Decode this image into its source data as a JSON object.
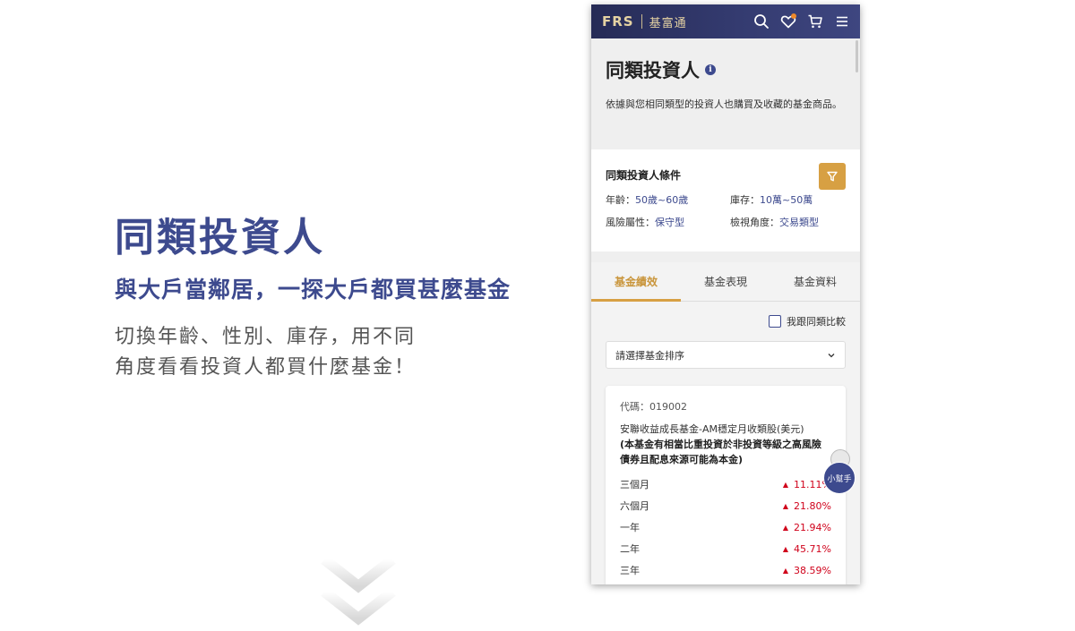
{
  "promo": {
    "title": "同類投資人",
    "subtitle": "與大戶當鄰居，一探大戶都買甚麼基金",
    "desc_line1": "切換年齡、性別、庫存，用不同",
    "desc_line2": "角度看看投資人都買什麼基金！"
  },
  "app": {
    "logo_brand": "FRS",
    "logo_name": "基富通"
  },
  "header": {
    "title": "同類投資人",
    "info_glyph": "i",
    "desc": "依據與您相同類型的投資人也購買及收藏的基金商品。"
  },
  "conditions": {
    "title": "同類投資人條件",
    "age_label": "年齡：",
    "age_value": "50歲~60歲",
    "stock_label": "庫存：",
    "stock_value": "10萬~50萬",
    "risk_label": "風險屬性：",
    "risk_value": "保守型",
    "view_label": "檢視角度：",
    "view_value": "交易類型"
  },
  "tabs": [
    {
      "label": "基金績效",
      "active": true
    },
    {
      "label": "基金表現",
      "active": false
    },
    {
      "label": "基金資料",
      "active": false
    }
  ],
  "compare": {
    "label": "我跟同類比較",
    "checked": false
  },
  "sort": {
    "selected": "請選擇基金排序"
  },
  "fund": {
    "code": "代碼：019002",
    "name": "安聯收益成長基金-AM穩定月收類股(美元)",
    "note": "(本基金有相當比重投資於非投資等級之高風險債券且配息來源可能為本金)",
    "performance": [
      {
        "period": "三個月",
        "value": "11.11%"
      },
      {
        "period": "六個月",
        "value": "21.80%"
      },
      {
        "period": "一年",
        "value": "21.94%"
      },
      {
        "period": "二年",
        "value": "45.71%"
      },
      {
        "period": "三年",
        "value": "38.59%"
      }
    ]
  },
  "helper": {
    "label": "小幫手"
  },
  "colors": {
    "brand_blue": "#3d4a8e",
    "gold": "#d7a043",
    "positive_red": "#d0021b"
  }
}
